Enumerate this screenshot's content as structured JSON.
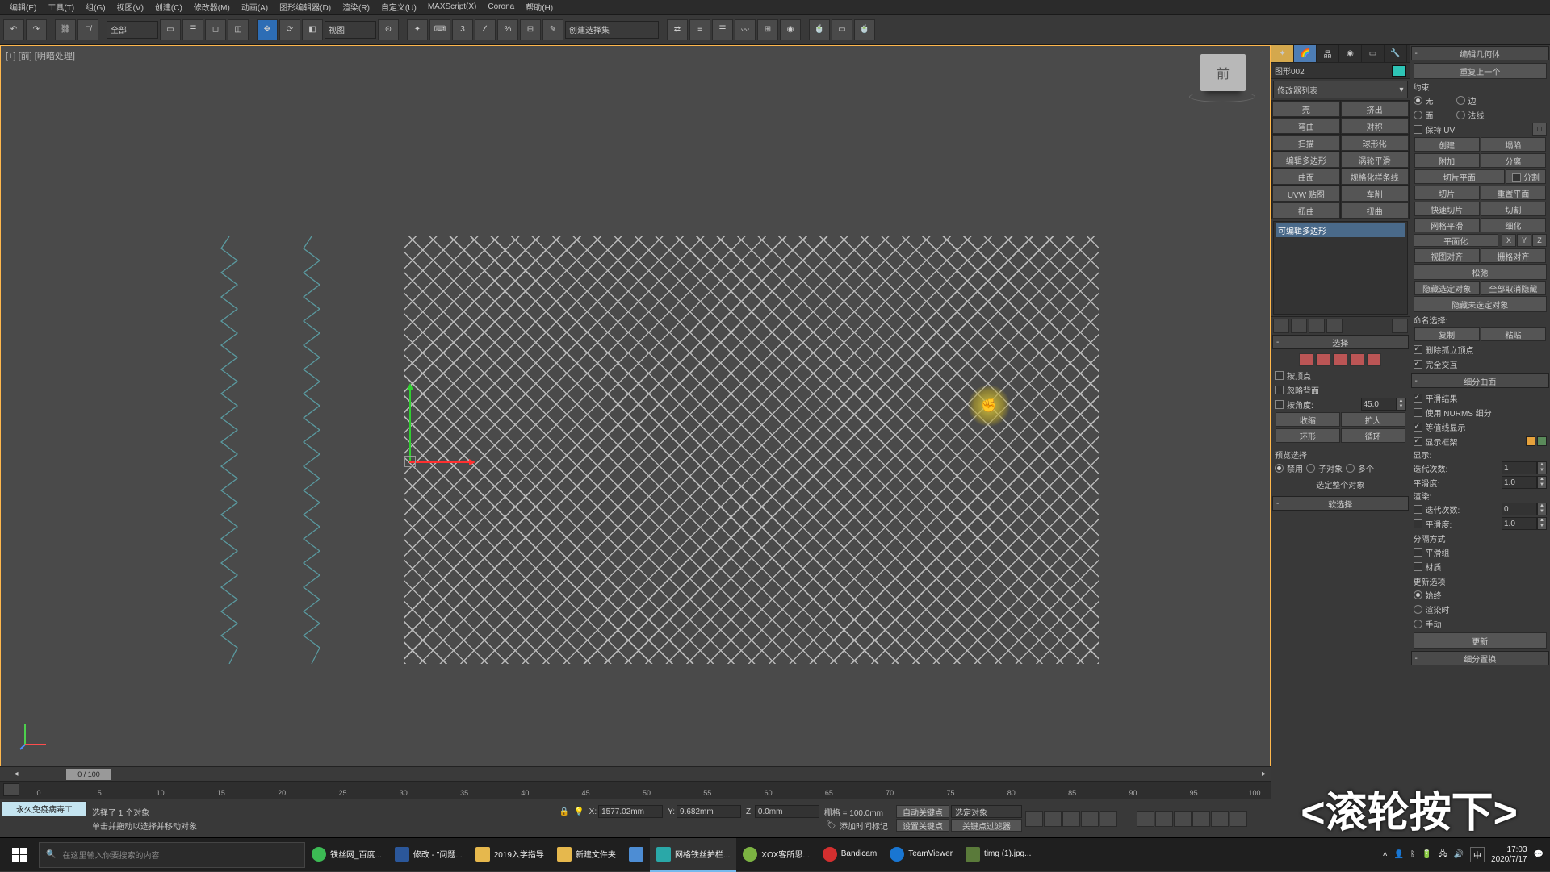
{
  "menu": {
    "items": [
      "编辑(E)",
      "工具(T)",
      "组(G)",
      "视图(V)",
      "创建(C)",
      "修改器(M)",
      "动画(A)",
      "图形编辑器(D)",
      "渲染(R)",
      "自定义(U)",
      "MAXScript(X)",
      "Corona",
      "帮助(H)"
    ]
  },
  "toolbar": {
    "filter_all": "全部",
    "ref_sys": "视图",
    "named_set": "创建选择集"
  },
  "viewport": {
    "label": "[+] [前] [明暗处理]",
    "cube_face": "前",
    "highlight_cursor": "✊"
  },
  "timeline": {
    "display": "0 / 100",
    "ticks": [
      0,
      5,
      10,
      15,
      20,
      25,
      30,
      35,
      40,
      45,
      50,
      55,
      60,
      65,
      70,
      75,
      80,
      85,
      90,
      95,
      100
    ]
  },
  "cmd": {
    "object_name": "图形002",
    "modifier_placeholder": "修改器列表",
    "quick_buttons": [
      [
        "壳",
        "挤出"
      ],
      [
        "弯曲",
        "对称"
      ],
      [
        "扫描",
        "球形化"
      ],
      [
        "编辑多边形",
        "涡轮平滑"
      ],
      [
        "曲面",
        "规格化样条线"
      ],
      [
        "UVW 贴图",
        "车削"
      ],
      [
        "扭曲",
        "扭曲"
      ]
    ],
    "stack_item": "可编辑多边形",
    "roll_select": "选择",
    "by_vertex": "按顶点",
    "ignore_bf": "忽略背面",
    "by_angle": "按角度:",
    "angle_val": "45.0",
    "shrink": "收缩",
    "grow": "扩大",
    "ring": "环形",
    "loop": "循环",
    "preview_sel": "预览选择",
    "psel_off": "禁用",
    "psel_sub": "子对象",
    "psel_multi": "多个",
    "sel_whole": "选定整个对象",
    "roll_soft": "软选择"
  },
  "edit": {
    "header": "编辑几何体",
    "repeat": "重复上一个",
    "constrain": "约束",
    "c_none": "无",
    "c_edge": "边",
    "c_face": "面",
    "c_normal": "法线",
    "preserve_uv": "保持 UV",
    "create": "创建",
    "collapse": "塌陷",
    "attach": "附加",
    "detach": "分离",
    "slice_plane": "切片平面",
    "split": "分割",
    "slice": "切片",
    "reset_plane": "重置平面",
    "quickslice": "快速切片",
    "cut": "切割",
    "msmooth": "网格平滑",
    "tess": "细化",
    "planar": "平面化",
    "x": "X",
    "y": "Y",
    "z": "Z",
    "view_align": "视图对齐",
    "grid_align": "栅格对齐",
    "relax": "松弛",
    "hide_sel": "隐藏选定对象",
    "unhide_all": "全部取消隐藏",
    "hide_unsel": "隐藏未选定对象",
    "named_sel": "命名选择:",
    "copy": "复制",
    "paste": "粘贴",
    "del_iso": "删除孤立顶点",
    "full_inter": "完全交互",
    "subdiv_header": "细分曲面",
    "smooth_res": "平滑结果",
    "use_nurms": "使用 NURMS 细分",
    "iso_display": "等值线显示",
    "show_cage": "显示框架",
    "display_lbl": "显示:",
    "iter": "迭代次数:",
    "iter_v": "1",
    "smooth": "平滑度:",
    "smooth_v": "1.0",
    "render_lbl": "渲染:",
    "iter2_v": "0",
    "smooth2_v": "1.0",
    "sep_by": "分隔方式",
    "sm_groups": "平滑组",
    "materials": "材质",
    "update_opts": "更新选项",
    "u_always": "始终",
    "u_render": "渲染时",
    "u_manual": "手动",
    "update_btn": "更新",
    "subdiv_disp": "细分置换"
  },
  "status": {
    "permanent": "永久免疫病毒工",
    "line1": "选择了 1 个对象",
    "line2": "单击并拖动以选择并移动对象",
    "x_lbl": "X:",
    "x_v": "1577.02mm",
    "y_lbl": "Y:",
    "y_v": "9.682mm",
    "z_lbl": "Z:",
    "z_v": "0.0mm",
    "grid": "栅格 = 100.0mm",
    "add_time": "添加时间标记",
    "autokey": "自动关键点",
    "selkey": "选定对象",
    "setkey": "设置关键点",
    "keyfilter": "关键点过滤器"
  },
  "overlay": "<滚轮按下>",
  "taskbar": {
    "search_ph": "在这里输入你要搜索的内容",
    "items": [
      "铁丝网_百度...",
      "修改 - \"问题...",
      "2019入学指导",
      "新建文件夹",
      "",
      "网格铁丝护栏...",
      "XOX客所思...",
      "Bandicam",
      "TeamViewer",
      "timg (1).jpg..."
    ],
    "ime": "中",
    "time": "17:03",
    "date": "2020/7/17"
  }
}
